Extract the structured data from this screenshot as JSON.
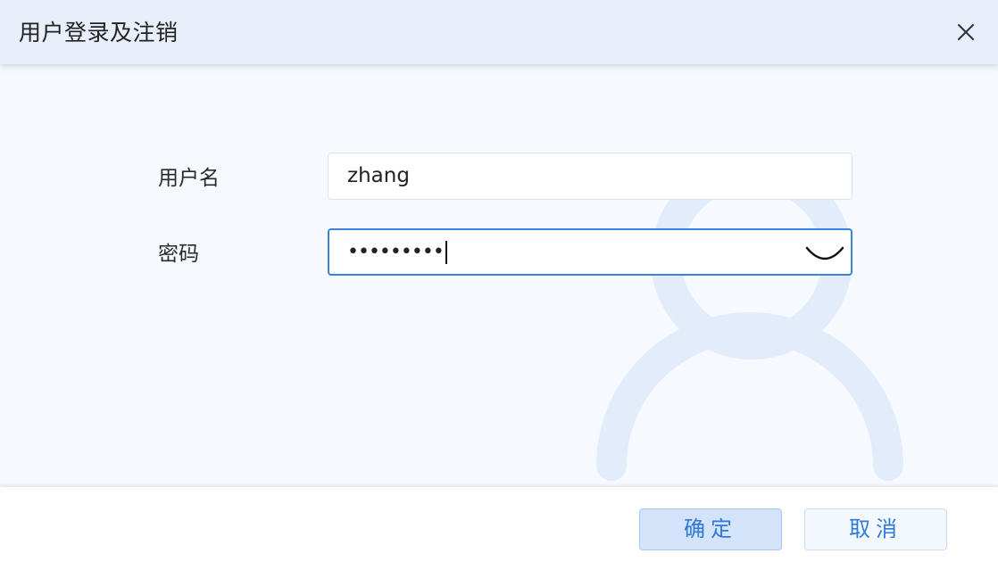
{
  "dialog": {
    "title": "用户登录及注销",
    "close_icon": "close-icon"
  },
  "form": {
    "username_label": "用户名",
    "username_value": "zhang",
    "password_label": "密码",
    "password_value": "•••••••••",
    "password_toggle_icon": "eye-closed-icon"
  },
  "footer": {
    "ok_label": "确定",
    "cancel_label": "取消"
  },
  "colors": {
    "header_bg": "#e8effb",
    "body_bg": "#f6f9fe",
    "accent": "#2f7ad6",
    "watermark": "#e3ecfb"
  }
}
